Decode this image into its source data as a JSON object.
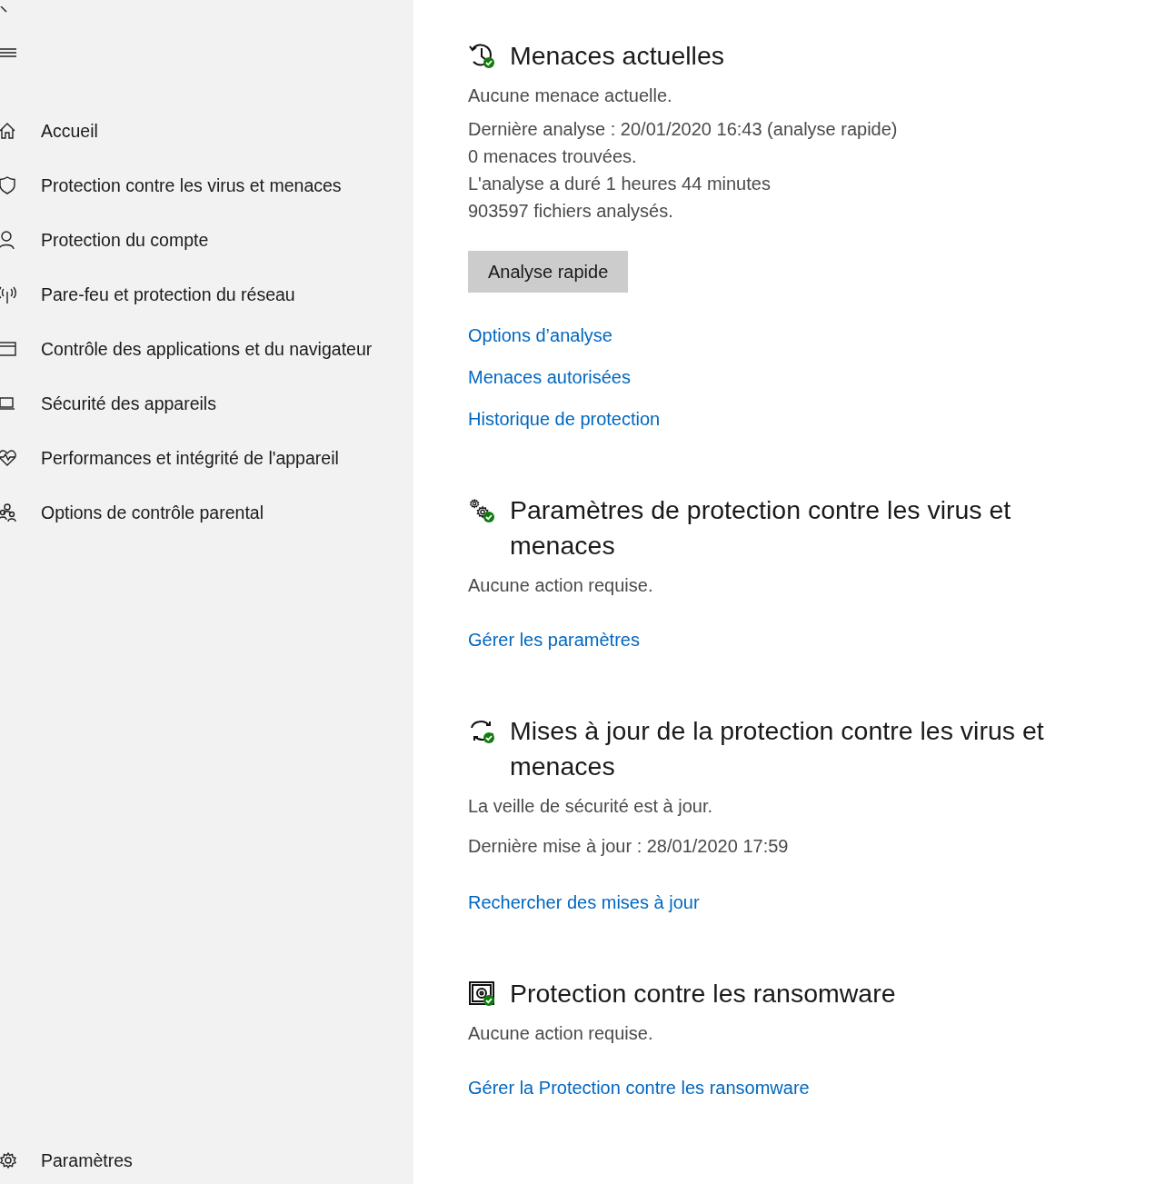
{
  "sidebar": {
    "items": [
      {
        "label": "Accueil",
        "selected": false
      },
      {
        "label": "Protection contre les virus et menaces",
        "selected": false
      },
      {
        "label": "Protection du compte",
        "selected": false
      },
      {
        "label": "Pare-feu et protection du réseau",
        "selected": false
      },
      {
        "label": "Contrôle des applications et du navigateur",
        "selected": false
      },
      {
        "label": "Sécurité des appareils",
        "selected": false
      },
      {
        "label": "Performances et intégrité de l'appareil",
        "selected": false
      },
      {
        "label": "Options de contrôle parental",
        "selected": false
      }
    ],
    "settings": {
      "label": "Paramètres"
    }
  },
  "sections": [
    {
      "title": "Menaces actuelles",
      "protected": true,
      "status": "Aucune menace actuelle.",
      "details": [
        "Dernière analyse : 20/01/2020 16:43 (analyse rapide)",
        "0 menaces trouvées.",
        "L'analyse a duré 1 heures 44 minutes",
        "903597 fichiers analysés."
      ],
      "button": "Analyse rapide",
      "links": [
        "Options d’analyse",
        "Menaces autorisées",
        "Historique de protection"
      ]
    },
    {
      "title": "Paramètres de protection contre les virus et menaces",
      "protected": true,
      "status": "Aucune action requise.",
      "links": [
        "Gérer les paramètres"
      ]
    },
    {
      "title": "Mises à jour de la protection contre les virus et menaces",
      "protected": true,
      "status": "La veille de sécurité est à jour.",
      "details": [
        "Dernière mise à jour : 28/01/2020 17:59"
      ],
      "links": [
        "Rechercher des mises à jour"
      ]
    },
    {
      "title": "Protection contre les ransomware",
      "protected": true,
      "status": "Aucune action requise.",
      "links": [
        "Gérer la Protection contre les ransomware"
      ]
    }
  ]
}
